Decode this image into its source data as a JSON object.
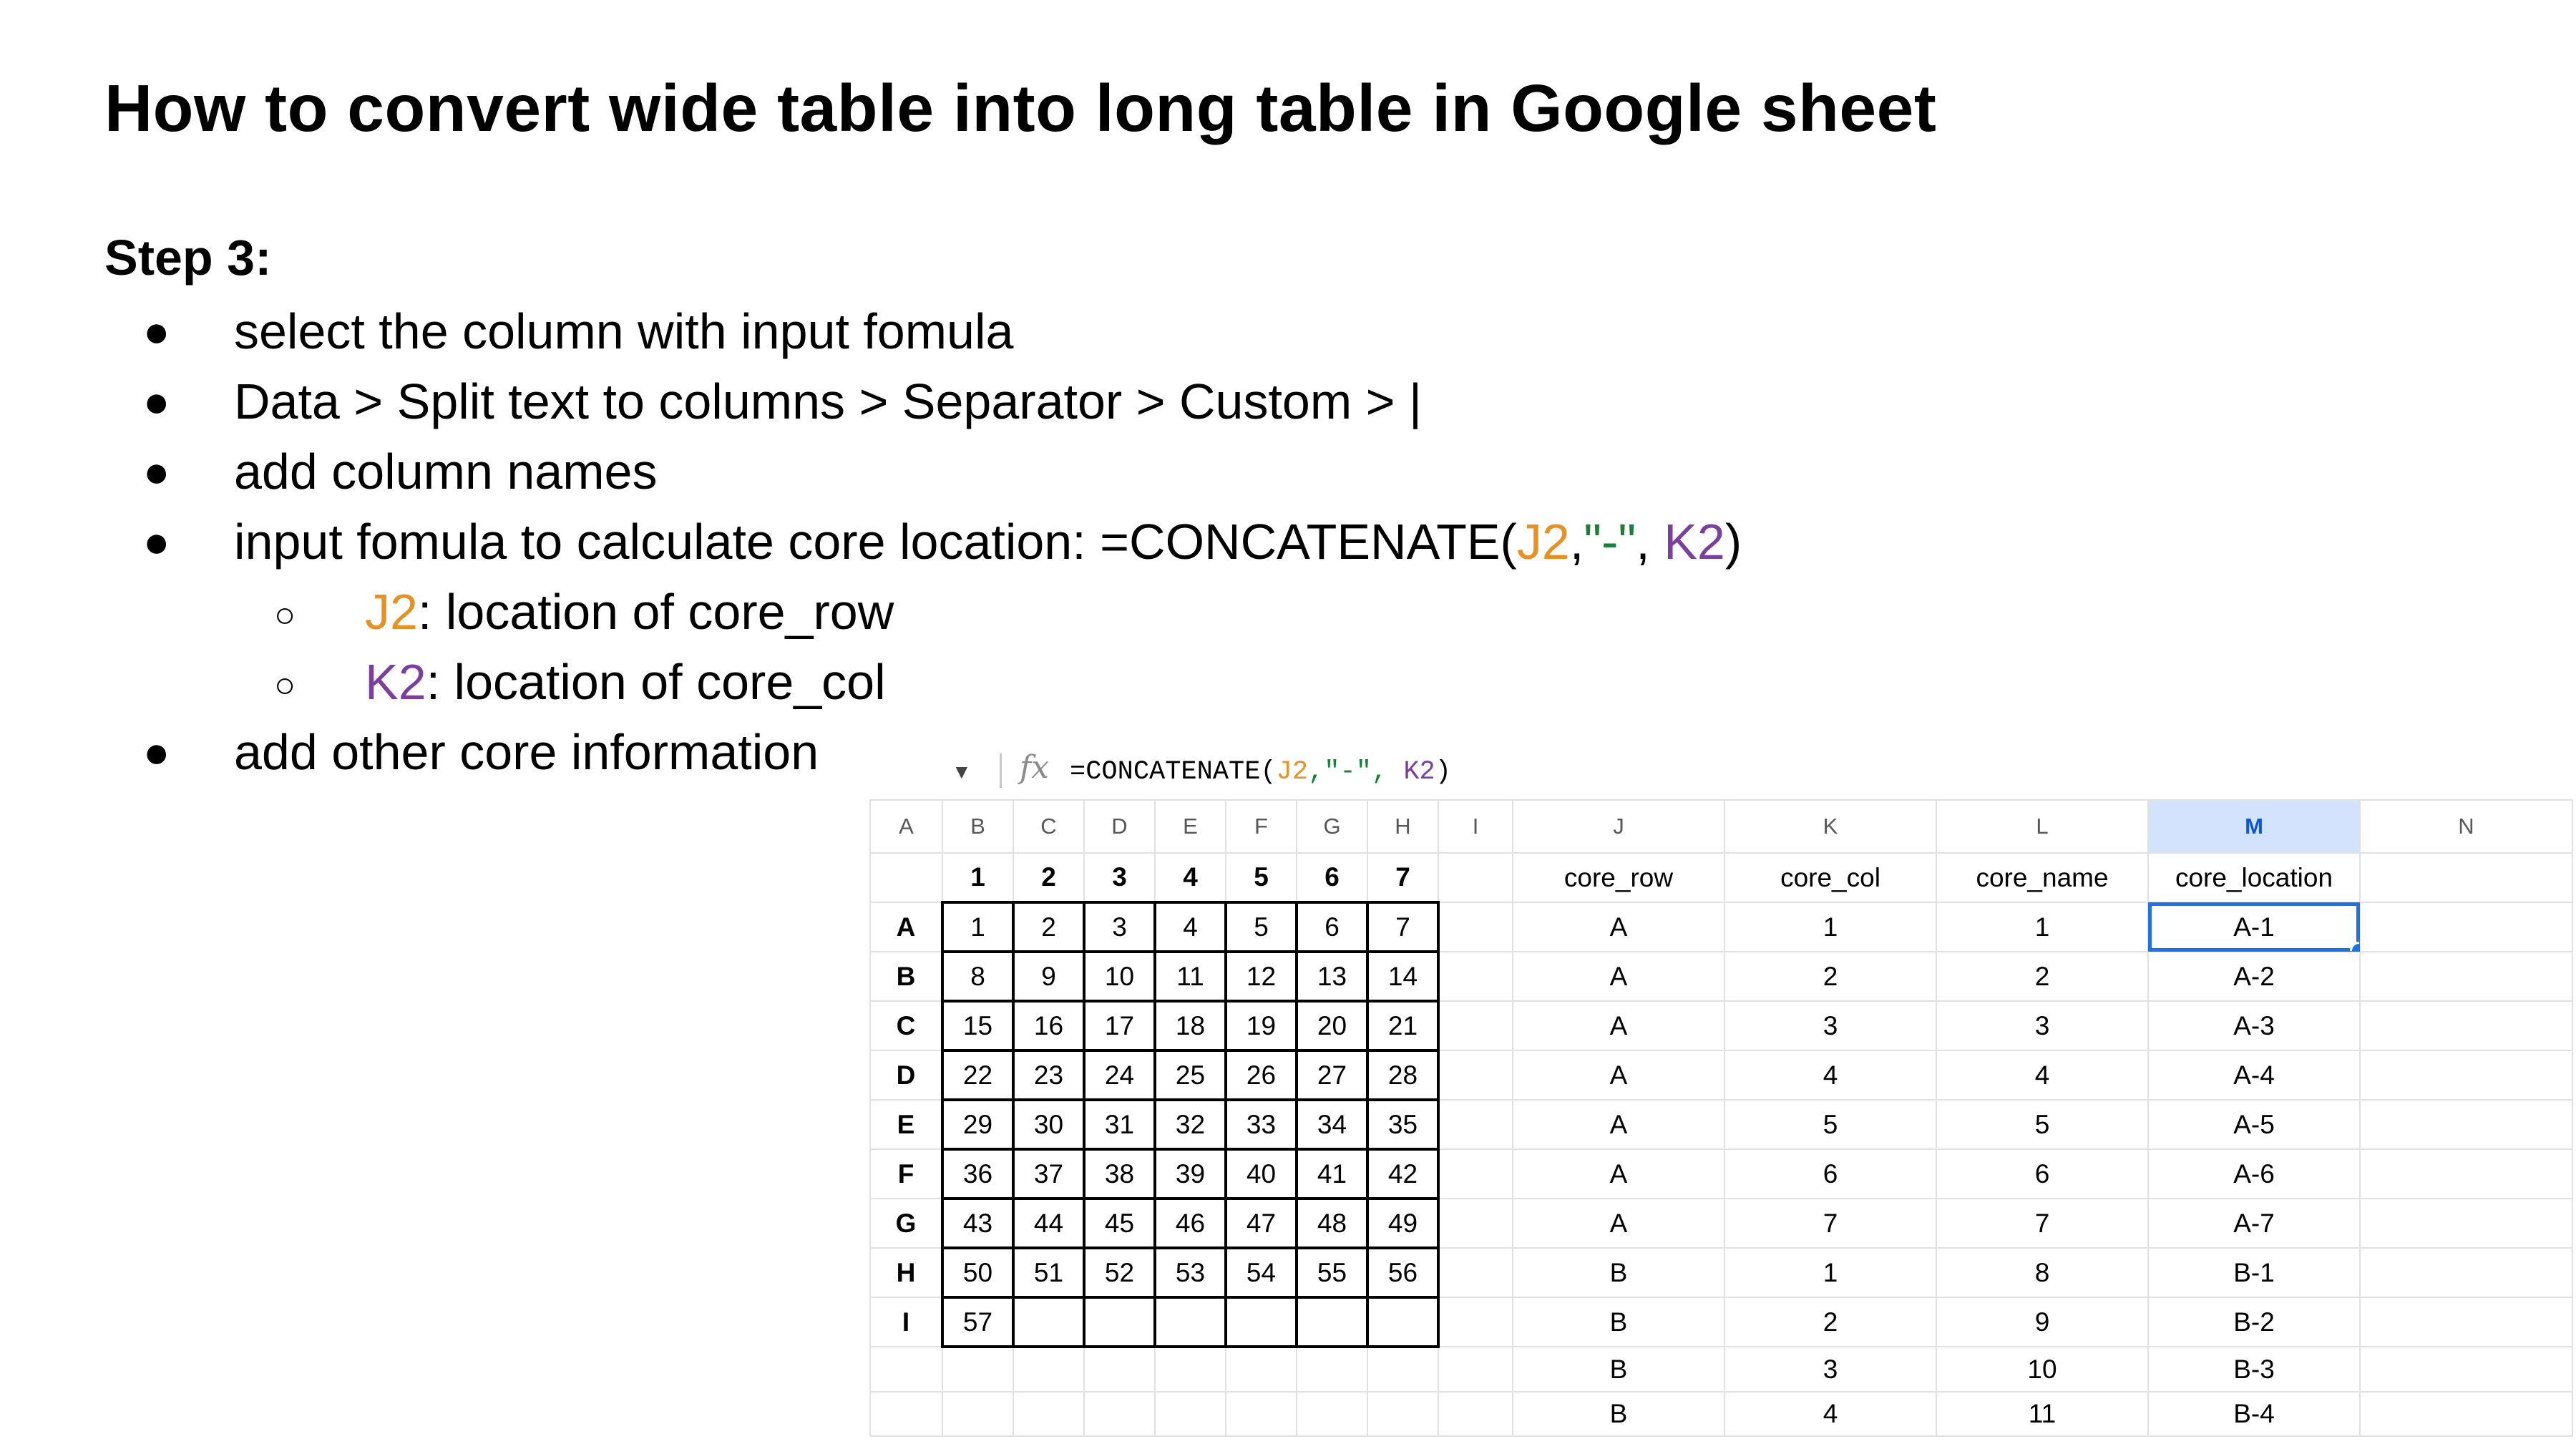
{
  "title": "How to convert wide table into long table in Google sheet",
  "step_label": "Step 3:",
  "bullets": {
    "b1": "select the column with input fomula",
    "b2": "Data > Split text to columns > Separator > Custom > |",
    "b3": "add column names",
    "b4_prefix": "input fomula to calculate core location: =CONCATENATE(",
    "b4_j2": "J2",
    "b4_comma1": ",",
    "b4_dash": "\"-\"",
    "b4_comma2": ", ",
    "b4_k2": "K2",
    "b4_close": ")",
    "sub1_ref": "J2",
    "sub1_text": ": location of core_row",
    "sub2_ref": "K2",
    "sub2_text": ": location of core_col",
    "b5": "add other core information",
    "bullet_glyph": "●",
    "sub_glyph": "○"
  },
  "formula_bar": {
    "dropdown_glyph": "▼",
    "fx_label": "fx",
    "f_prefix": "=CONCATENATE(",
    "f_j2": "J2",
    "f_dash": ",\"-\", ",
    "f_k2": "K2",
    "f_close": ")"
  },
  "sheet": {
    "col_headers": [
      "A",
      "B",
      "C",
      "D",
      "E",
      "F",
      "G",
      "H",
      "I",
      "J",
      "K",
      "L",
      "M",
      "N"
    ],
    "selected_col": "M",
    "row1": [
      "",
      "1",
      "2",
      "3",
      "4",
      "5",
      "6",
      "7",
      "",
      "core_row",
      "core_col",
      "core_name",
      "core_location",
      ""
    ],
    "rows": [
      [
        "A",
        "1",
        "2",
        "3",
        "4",
        "5",
        "6",
        "7",
        "",
        "A",
        "1",
        "1",
        "A-1",
        ""
      ],
      [
        "B",
        "8",
        "9",
        "10",
        "11",
        "12",
        "13",
        "14",
        "",
        "A",
        "2",
        "2",
        "A-2",
        ""
      ],
      [
        "C",
        "15",
        "16",
        "17",
        "18",
        "19",
        "20",
        "21",
        "",
        "A",
        "3",
        "3",
        "A-3",
        ""
      ],
      [
        "D",
        "22",
        "23",
        "24",
        "25",
        "26",
        "27",
        "28",
        "",
        "A",
        "4",
        "4",
        "A-4",
        ""
      ],
      [
        "E",
        "29",
        "30",
        "31",
        "32",
        "33",
        "34",
        "35",
        "",
        "A",
        "5",
        "5",
        "A-5",
        ""
      ],
      [
        "F",
        "36",
        "37",
        "38",
        "39",
        "40",
        "41",
        "42",
        "",
        "A",
        "6",
        "6",
        "A-6",
        ""
      ],
      [
        "G",
        "43",
        "44",
        "45",
        "46",
        "47",
        "48",
        "49",
        "",
        "A",
        "7",
        "7",
        "A-7",
        ""
      ],
      [
        "H",
        "50",
        "51",
        "52",
        "53",
        "54",
        "55",
        "56",
        "",
        "B",
        "1",
        "8",
        "B-1",
        ""
      ],
      [
        "I",
        "57",
        "",
        "",
        "",
        "",
        "",
        "",
        "",
        "B",
        "2",
        "9",
        "B-2",
        ""
      ],
      [
        "",
        "",
        "",
        "",
        "",
        "",
        "",
        "",
        "",
        "B",
        "3",
        "10",
        "B-3",
        ""
      ],
      [
        "",
        "",
        "",
        "",
        "",
        "",
        "",
        "",
        "",
        "B",
        "4",
        "11",
        "B-4",
        ""
      ]
    ]
  },
  "colors": {
    "j2_orange": "#e69125",
    "dash_green": "#188038",
    "k2_purple": "#7b3f9e",
    "selection_blue": "#1a73e8",
    "header_selected_bg": "#d3e3fd"
  }
}
